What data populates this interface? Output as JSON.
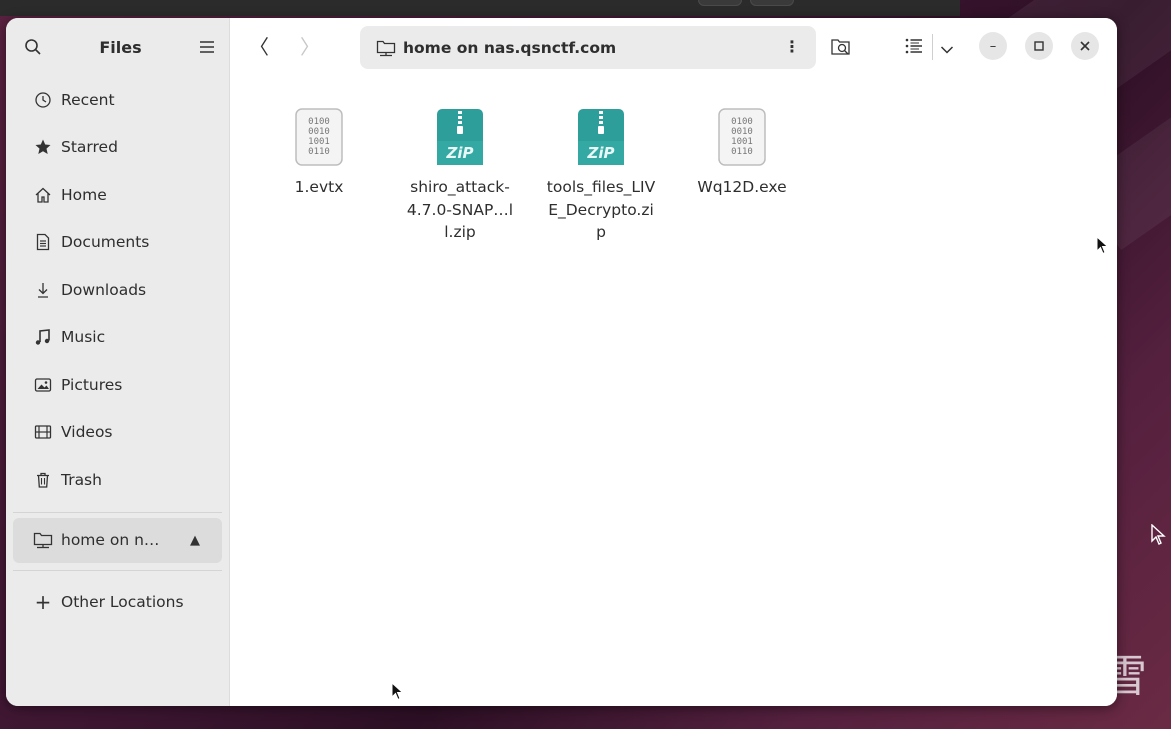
{
  "sidebar": {
    "title": "Files",
    "items": [
      {
        "label": "Recent",
        "icon": "clock-icon"
      },
      {
        "label": "Starred",
        "icon": "star-icon"
      },
      {
        "label": "Home",
        "icon": "home-icon"
      },
      {
        "label": "Documents",
        "icon": "document-icon"
      },
      {
        "label": "Downloads",
        "icon": "download-icon"
      },
      {
        "label": "Music",
        "icon": "music-icon"
      },
      {
        "label": "Pictures",
        "icon": "picture-icon"
      },
      {
        "label": "Videos",
        "icon": "video-icon"
      },
      {
        "label": "Trash",
        "icon": "trash-icon"
      }
    ],
    "mounted": {
      "label": "home on n…",
      "icon": "network-folder-icon",
      "eject_icon": "eject-icon"
    },
    "other_locations": {
      "label": "Other Locations",
      "icon": "plus-icon"
    }
  },
  "header": {
    "path": "home on nas.qsnctf.com",
    "path_icon": "network-folder-icon"
  },
  "files": [
    {
      "name": "1.evtx",
      "type": "binary"
    },
    {
      "name": "shiro_attack-4.7.0-SNAP…ll.zip",
      "type": "zip"
    },
    {
      "name": "tools_files_LIVE_Decrypto.zip",
      "type": "zip"
    },
    {
      "name": "Wq12D.exe",
      "type": "binary"
    }
  ],
  "icons": {
    "binary_lines": [
      "0100",
      "0010",
      "1001",
      "0110"
    ],
    "zip_label": "ZiP"
  },
  "colors": {
    "zip_teal": "#2e9e9a",
    "sidebar_bg": "#ebebeb",
    "desktop_bg": "#3b1530"
  },
  "watermark": "看雪"
}
